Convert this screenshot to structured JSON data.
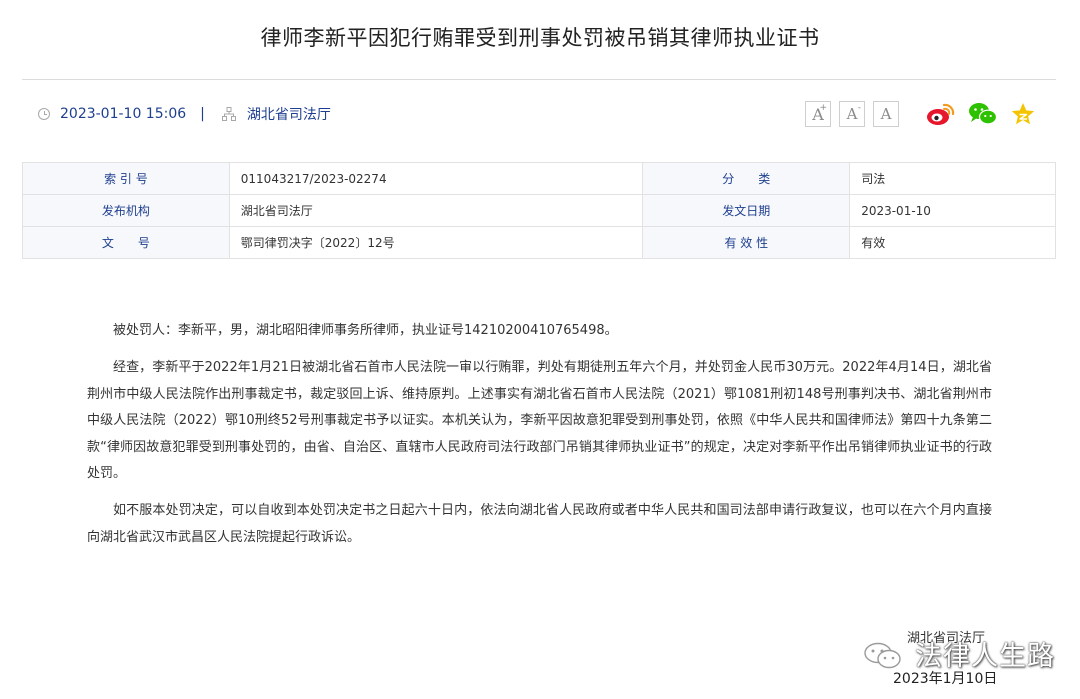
{
  "title": "律师李新平因犯行贿罪受到刑事处罚被吊销其律师执业证书",
  "meta": {
    "datetime": "2023-01-10 15:06",
    "separator": "|",
    "publisher": "湖北省司法厅"
  },
  "font_controls": {
    "increase": "A",
    "increase_sup": "+",
    "decrease": "A",
    "decrease_sup": "-",
    "default": "A"
  },
  "share_icons": [
    "weibo-icon",
    "wechat-icon",
    "favorite-star-icon"
  ],
  "info": {
    "index_label": "索 引 号",
    "index_value": "011043217/2023-02274",
    "category_label": "分　　类",
    "category_value": "司法",
    "issuer_label": "发布机构",
    "issuer_value": "湖北省司法厅",
    "date_label": "发文日期",
    "date_value": "2023-01-10",
    "docno_label": "文　　号",
    "docno_value": "鄂司律罚决字〔2022〕12号",
    "validity_label": "有 效 性",
    "validity_value": "有效"
  },
  "body": {
    "p1": "被处罚人：李新平，男，湖北昭阳律师事务所律师，执业证号14210200410765498。",
    "p2": "经查，李新平于2022年1月21日被湖北省石首市人民法院一审以行贿罪，判处有期徒刑五年六个月，并处罚金人民币30万元。2022年4月14日，湖北省荆州市中级人民法院作出刑事裁定书，裁定驳回上诉、维持原判。上述事实有湖北省石首市人民法院（2021）鄂1081刑初148号刑事判决书、湖北省荆州市中级人民法院（2022）鄂10刑终52号刑事裁定书予以证实。本机关认为，李新平因故意犯罪受到刑事处罚，依照《中华人民共和国律师法》第四十九条第二款“律师因故意犯罪受到刑事处罚的，由省、自治区、直辖市人民政府司法行政部门吊销其律师执业证书”的规定，决定对李新平作出吊销律师执业证书的行政处罚。",
    "p3": "如不服本处罚决定，可以自收到本处罚决定书之日起六十日内，依法向湖北省人民政府或者中华人民共和国司法部申请行政复议，也可以在六个月内直接向湖北省武汉市武昌区人民法院提起行政诉讼。"
  },
  "signature": {
    "org": "湖北省司法厅",
    "watermark": "法律人生路",
    "date": "2023年1月10日"
  },
  "colors": {
    "label_blue": "#1e3f8f",
    "weibo_red": "#e6162d",
    "wechat_green": "#2dc100",
    "star_yellow": "#f5c400"
  }
}
